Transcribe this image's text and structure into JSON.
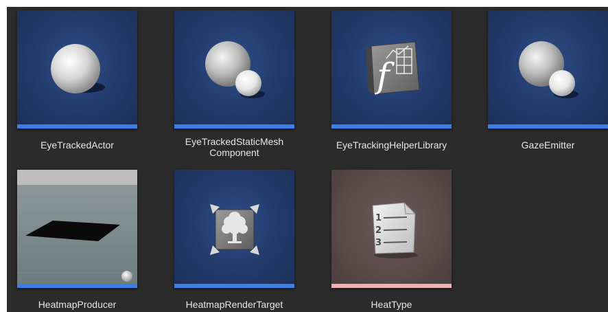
{
  "assets": [
    {
      "name": "EyeTrackedActor",
      "icon": "sphere-icon",
      "stripe_color": "#3f7de6"
    },
    {
      "name_line1": "EyeTrackedStaticMesh",
      "name_line2": "Component",
      "icon": "sphere-with-small-sphere-icon",
      "stripe_color": "#3f7de6"
    },
    {
      "name": "EyeTrackingHelperLibrary",
      "icon": "function-library-icon",
      "stripe_color": "#3f7de6"
    },
    {
      "name": "GazeEmitter",
      "icon": "sphere-with-small-sphere-icon",
      "stripe_color": "#3f7de6"
    },
    {
      "name": "HeatmapProducer",
      "icon": "level-preview-thumbnail",
      "stripe_color": "#3f7de6"
    },
    {
      "name": "HeatmapRenderTarget",
      "icon": "render-target-tree-icon",
      "stripe_color": "#3f7de6"
    },
    {
      "name": "HeatType",
      "icon": "enum-list-icon",
      "stripe_color": "#f3b2b2"
    }
  ],
  "colors": {
    "background": "#2b2b2b",
    "tile_blue": "#223a6b",
    "tile_mauve": "#5a4a4a",
    "accent_blue": "#3f7de6",
    "accent_pink": "#f3b2b2"
  }
}
